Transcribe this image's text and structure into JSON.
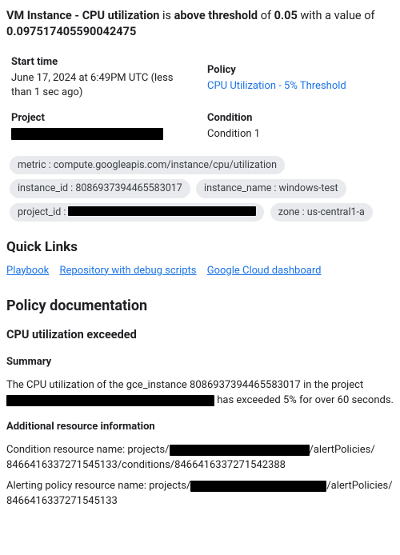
{
  "headline": {
    "resource": "VM Instance - CPU utilization",
    "mid1": " is ",
    "state": "above threshold",
    "mid2": " of ",
    "threshold": "0.05",
    "mid3": " with a value of ",
    "value": "0.097517405590042475"
  },
  "meta": {
    "start_label": "Start time",
    "start_value": "June 17, 2024 at 6:49PM UTC (less than 1 sec ago)",
    "policy_label": "Policy",
    "policy_link": "CPU Utilization - 5% Threshold",
    "project_label": "Project",
    "condition_label": "Condition",
    "condition_value": "Condition 1"
  },
  "chips": {
    "metric": "metric : compute.googleapis.com/instance/cpu/utilization",
    "instance_id": "instance_id : 8086937394465583017",
    "instance_name": "instance_name : windows-test",
    "project_id_prefix": "project_id : ",
    "zone": "zone : us-central1-a"
  },
  "quick": {
    "heading": "Quick Links",
    "playbook": "Playbook",
    "repo": "Repository with debug scripts",
    "dashboard": "Google Cloud dashboard"
  },
  "doc": {
    "heading": "Policy documentation",
    "sub": "CPU utilization exceeded",
    "summary_h": "Summary",
    "summary_1": "The CPU utilization of the gce_instance 8086937394465583017 in the project ",
    "summary_2": " has exceeded 5% for over 60 seconds.",
    "add_h": "Additional resource information",
    "cond_1": "Condition resource name: projects/",
    "cond_2": "/alertPolicies/",
    "cond_3": "8466416337271545133/conditions/8466416337271542388",
    "pol_1": "Alerting policy resource name: projects/",
    "pol_2": "/alertPolicies/",
    "pol_3": "8466416337271545133"
  }
}
